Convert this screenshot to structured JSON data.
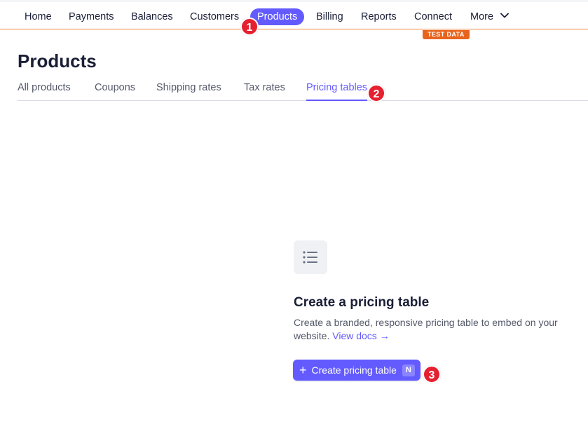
{
  "topnav": {
    "items": [
      {
        "label": "Home"
      },
      {
        "label": "Payments"
      },
      {
        "label": "Balances"
      },
      {
        "label": "Customers"
      },
      {
        "label": "Products",
        "active": true
      },
      {
        "label": "Billing"
      },
      {
        "label": "Reports"
      },
      {
        "label": "Connect"
      },
      {
        "label": "More"
      }
    ],
    "test_badge": "TEST DATA"
  },
  "markers": [
    "1",
    "2",
    "3"
  ],
  "page": {
    "title": "Products",
    "tabs": [
      {
        "label": "All products"
      },
      {
        "label": "Coupons"
      },
      {
        "label": "Shipping rates"
      },
      {
        "label": "Tax rates"
      },
      {
        "label": "Pricing tables",
        "active": true
      }
    ]
  },
  "empty_state": {
    "icon": "list-icon",
    "title": "Create a pricing table",
    "description": "Create a branded, responsive pricing table to embed on your website.",
    "link_label": "View docs",
    "link_arrow": "→",
    "button_label": "Create pricing table",
    "button_plus": "+",
    "button_shortcut": "N"
  },
  "colors": {
    "accent": "#635bff",
    "test_badge": "#e8641e",
    "marker": "#e5202f"
  }
}
